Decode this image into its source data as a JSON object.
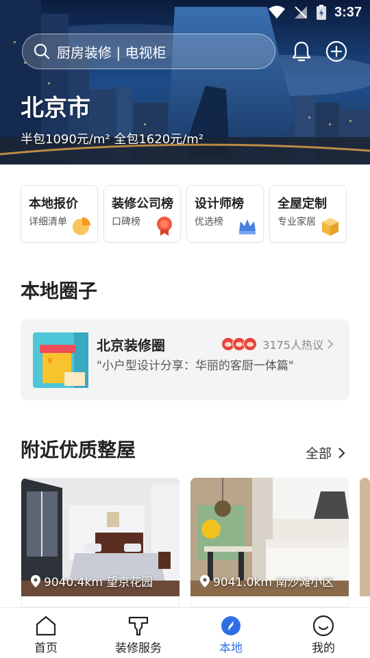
{
  "status_bar": {
    "time": "3:37"
  },
  "search": {
    "placeholder": "厨房装修 | 电视柜"
  },
  "location": {
    "city": "北京市",
    "price_summary": "半包1090元/m² 全包1620元/m²"
  },
  "quick_cards": [
    {
      "title": "本地报价",
      "subtitle": "详细清单",
      "icon": "pie-chart-icon",
      "color": "#f6a623"
    },
    {
      "title": "装修公司榜",
      "subtitle": "口碑榜",
      "icon": "award-ribbon-icon",
      "color": "#f05a3c"
    },
    {
      "title": "设计师榜",
      "subtitle": "优选榜",
      "icon": "crown-icon",
      "color": "#4a7fe0"
    },
    {
      "title": "全屋定制",
      "subtitle": "专业家居",
      "icon": "cube-icon",
      "color": "#f3b73b"
    }
  ],
  "circle_section": {
    "title": "本地圈子",
    "card": {
      "name": "北京装修圈",
      "count": "3175人热议",
      "post": "\"小户型设计分享：华丽的客厨一体篇\""
    }
  },
  "nearby_section": {
    "title": "附近优质整屋",
    "all_label": "全部",
    "items": [
      {
        "distance": "9040.4km 望京花园"
      },
      {
        "distance": "9041.0km 南沙滩小区"
      }
    ]
  },
  "tabbar": {
    "items": [
      {
        "label": "首页",
        "icon": "home-icon"
      },
      {
        "label": "装修服务",
        "icon": "service-icon"
      },
      {
        "label": "本地",
        "icon": "compass-icon",
        "active": true
      },
      {
        "label": "我的",
        "icon": "smiley-icon"
      }
    ],
    "active_color": "#2f6fe4"
  }
}
